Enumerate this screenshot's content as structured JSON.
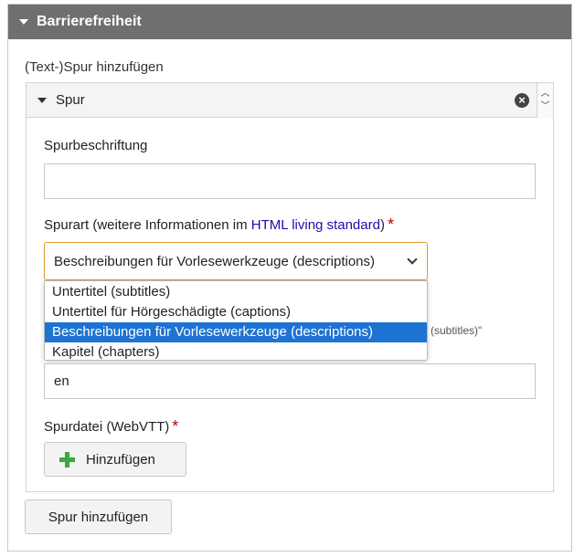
{
  "panel": {
    "title": "Barrierefreiheit"
  },
  "section": {
    "label": "(Text-)Spur hinzufügen"
  },
  "track": {
    "header_label": "Spur",
    "label_field": {
      "label": "Spurbeschriftung",
      "value": ""
    },
    "kind_field": {
      "label_prefix": "Spurart (weitere Informationen im ",
      "link_text": "HTML living standard",
      "label_suffix": ")",
      "required_mark": "*",
      "selected_value": "Beschreibungen für Vorlesewerkzeuge (descriptions)",
      "options": [
        "Untertitel (subtitles)",
        "Untertitel für Hörgeschädigte (captions)",
        "Beschreibungen für Vorlesewerkzeuge (descriptions)",
        "Kapitel (chapters)"
      ],
      "selected_index": 2
    },
    "hint_fragment": "titel (subtitles)\"",
    "language_field": {
      "value": "en"
    },
    "file_field": {
      "label": "Spurdatei (WebVTT)",
      "required_mark": "*",
      "add_button": "Hinzufügen"
    }
  },
  "add_track_button": "Spur hinzufügen",
  "colors": {
    "header_bg": "#6f6f6f",
    "select_border": "#e09a2e",
    "selected_option": "#1e73d2",
    "required": "#c00000",
    "link": "#1a0dab",
    "plus": "#3aaa3a"
  }
}
